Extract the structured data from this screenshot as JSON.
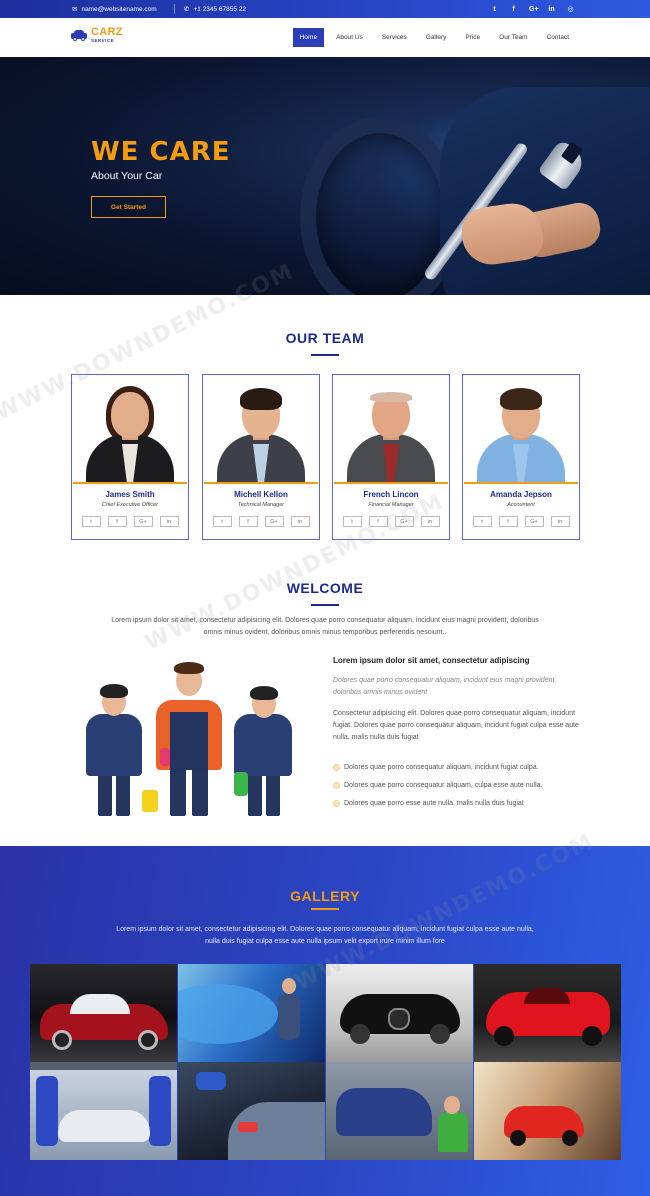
{
  "topbar": {
    "email": "name@websitename.com",
    "phone": "+1 2345 67855 22",
    "social": [
      {
        "icon": "twitter-icon",
        "glyph": "t"
      },
      {
        "icon": "facebook-icon",
        "glyph": "f"
      },
      {
        "icon": "google-plus-icon",
        "glyph": "G+"
      },
      {
        "icon": "linkedin-icon",
        "glyph": "in"
      },
      {
        "icon": "instagram-icon",
        "glyph": "◎"
      }
    ]
  },
  "logo": {
    "brand": "CARZ",
    "sub": "SERVICE"
  },
  "nav": {
    "items": [
      "Home",
      "About Us",
      "Services",
      "Gallery",
      "Price",
      "Our Team",
      "Contact"
    ],
    "active": "Home"
  },
  "hero": {
    "title": "WE CARE",
    "subtitle": "About Your Car",
    "cta": "Get Started"
  },
  "team": {
    "title": "OUR TEAM",
    "members": [
      {
        "name": "James Smith",
        "role": "Chief Executive Officer"
      },
      {
        "name": "Michell Kellon",
        "role": "Technical Manager"
      },
      {
        "name": "French Lincon",
        "role": "Financial Manager"
      },
      {
        "name": "Amanda Jepson",
        "role": "Accountent"
      }
    ],
    "social_glyphs": [
      "t",
      "f",
      "G+",
      "in"
    ]
  },
  "welcome": {
    "title": "WELCOME",
    "intro": "Lorem ipsum dolor sit amet, consectetur adipisicing elit. Dolores quae porro consequatur aliquam, incidunt eius magni provident, doloribus omnis minus ovident, doloribus omnis minus temporibus perferendis nesciunt..",
    "heading": "Lorem ipsum dolor sit amet, consectetur adipiscing",
    "italic": "Dolores quae porro consequatur aliquam, incidunt eius magni provident, doloribus omnis minus ovident",
    "para": "Consectetur adipisicing elit. Dolores quae porro consequatur aliquam, incidunt fugiat. Dolores quae porro consequatur aliquam, incidunt fugiat culpa esse aute nulla. malis nulla duis fugiat",
    "list": [
      "Dolores quae porro consequatur aliquam, incidunt fugiat culpa.",
      "Dolores quae porro consequatur aliquam, culpa esse aute nulla.",
      "Dolores quae porro esse aute nulla. malis nulla duis fugiat"
    ]
  },
  "gallery": {
    "title": "GALLERY",
    "text": "Lorem ipsum dolor sit amet, consectetur adipisicing elit. Dolores quae porro consequatur aliquam, incidunt fugiat culpa esse aute nulla, nulla duis fugiat culpa esse aute nulla ipsum velit export irure minim illum fore"
  },
  "watermark": "WWW.DOWNDEMO.COM",
  "colors": {
    "accent": "#f39c12",
    "primary": "#2b3eb8",
    "navy": "#1d2a8a"
  }
}
